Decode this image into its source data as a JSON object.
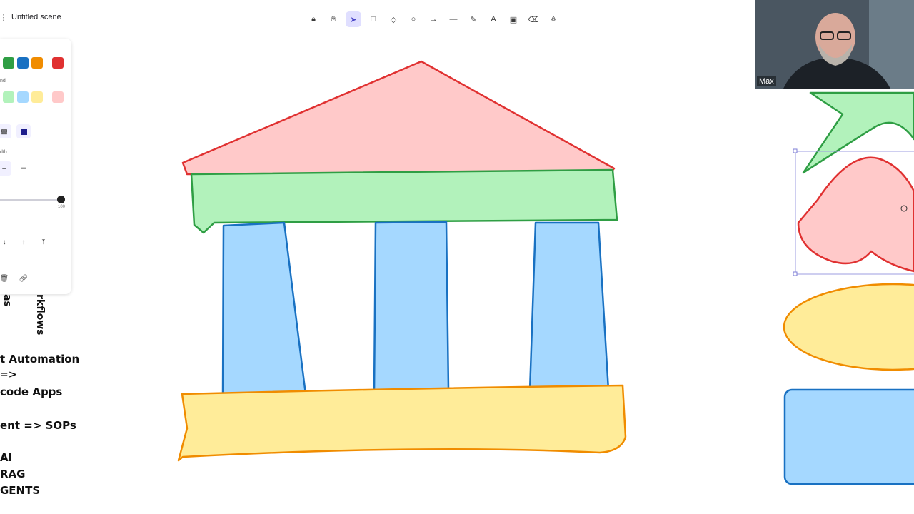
{
  "app": {
    "scene_title": "Untitled scene"
  },
  "toolbar": {
    "tools": [
      {
        "id": "lock",
        "icon": "lock-icon",
        "glyph": "🔒︎",
        "active": false
      },
      {
        "id": "hand",
        "icon": "hand-icon",
        "glyph": "✋︎",
        "active": false
      },
      {
        "id": "select",
        "icon": "cursor-icon",
        "glyph": "➤",
        "active": true
      },
      {
        "id": "rectangle",
        "icon": "rectangle-icon",
        "glyph": "□",
        "active": false
      },
      {
        "id": "diamond",
        "icon": "diamond-icon",
        "glyph": "◇",
        "active": false
      },
      {
        "id": "ellipse",
        "icon": "ellipse-icon",
        "glyph": "○",
        "active": false
      },
      {
        "id": "arrow",
        "icon": "arrow-icon",
        "glyph": "→",
        "active": false
      },
      {
        "id": "line",
        "icon": "line-icon",
        "glyph": "—",
        "active": false
      },
      {
        "id": "draw",
        "icon": "pencil-icon",
        "glyph": "✎",
        "active": false
      },
      {
        "id": "text",
        "icon": "text-icon",
        "glyph": "A",
        "active": false
      },
      {
        "id": "image",
        "icon": "image-icon",
        "glyph": "▣",
        "active": false
      },
      {
        "id": "eraser",
        "icon": "eraser-icon",
        "glyph": "⌫",
        "active": false
      },
      {
        "id": "library",
        "icon": "shapes-library-icon",
        "glyph": "⟁",
        "active": false
      }
    ]
  },
  "panel": {
    "stroke_colors": [
      "#2f9e44",
      "#1971c2",
      "#f08c00",
      "#e03131"
    ],
    "background_colors": [
      "#b2f2bb",
      "#a5d8ff",
      "#ffec99",
      "#ffc9c9"
    ],
    "background_label": "nd",
    "width_label": "dth",
    "opacity_max": "100",
    "fill_dark": "#1e1e8c"
  },
  "notes": {
    "vertical_left": "as",
    "vertical_right": "rkflows",
    "lines": [
      "t Automation",
      "=>",
      "code Apps",
      "ent => SOPs",
      "AI",
      "RAG",
      "GENTS"
    ]
  },
  "video": {
    "participant_name": "Max"
  },
  "colors": {
    "red_fill": "#ffc9c9",
    "red_stroke": "#e03131",
    "green_fill": "#b2f2bb",
    "green_stroke": "#2f9e44",
    "blue_fill": "#a5d8ff",
    "blue_stroke": "#1971c2",
    "yellow_fill": "#ffec99",
    "yellow_stroke": "#f08c00",
    "accent": "#e0dfff"
  }
}
